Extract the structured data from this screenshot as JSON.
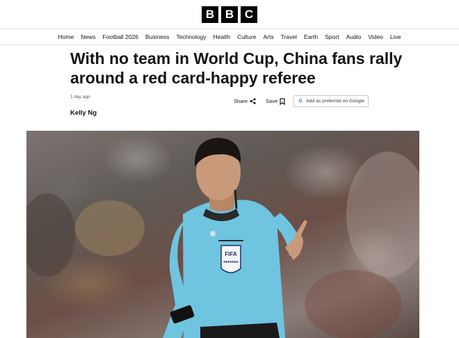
{
  "logo": {
    "letters": [
      "B",
      "B",
      "C"
    ]
  },
  "nav": {
    "items": [
      "Home",
      "News",
      "Football 2026",
      "Business",
      "Technology",
      "Health",
      "Culture",
      "Arts",
      "Travel",
      "Earth",
      "Sport",
      "Audio",
      "Video",
      "Live"
    ]
  },
  "article": {
    "headline": "With no team in World Cup, China fans rally around a red card-happy referee",
    "timestamp": "1 day ago",
    "byline": "Kelly Ng",
    "share_label": "Share",
    "save_label": "Save",
    "preferred_label": "Add as preferred on Google"
  },
  "hero_image": {
    "badge_line1": "FIFA",
    "badge_line2": "REFEREE"
  },
  "colors": {
    "shirt": "#6fc4df",
    "background": "#ffffff",
    "text": "#141414"
  },
  "icons": [
    "share-icon",
    "bookmark-icon",
    "google-icon"
  ]
}
